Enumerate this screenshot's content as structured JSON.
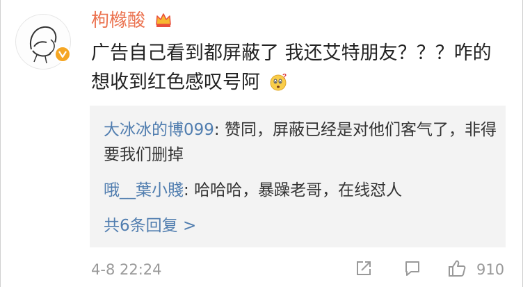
{
  "comment": {
    "username": "枸橼酸",
    "text": "广告自己看到都屏蔽了 我还艾特朋友？？？咋的 想收到红色感叹号阿",
    "emoji_icon": "thinking-face-icon"
  },
  "replies": [
    {
      "name": "大冰冰的博099",
      "sep": ": ",
      "text": "赞同，屏蔽已经是对他们客气了，非得要我们删掉"
    },
    {
      "name": "哦__葉小賤",
      "sep": ": ",
      "text": "哈哈哈，暴躁老哥，在线怼人"
    }
  ],
  "replies_more": "共6条回复 >",
  "footer": {
    "timestamp": "4-8 22:24",
    "like_count": "910"
  },
  "colors": {
    "username": "#eb7350",
    "link": "#507daf",
    "text": "#222222",
    "meta": "#999999",
    "reply_bg": "#f3f3f3",
    "verified_badge": "#f5a623"
  }
}
